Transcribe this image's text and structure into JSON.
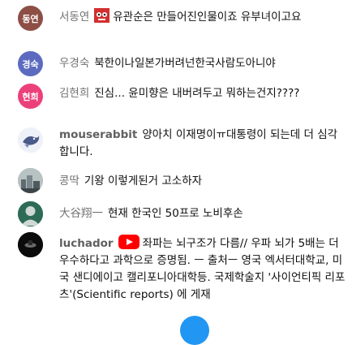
{
  "colors": {
    "avatar_1": "#8d4f45",
    "avatar_2": "#5c6bc0",
    "avatar_3": "#ec407a",
    "avatar_5": "#a9b0ad",
    "avatar_6": "#2e6b57",
    "avatar_7": "#111111",
    "fab": "#2196f3"
  },
  "messages": [
    {
      "avatar_text": "동연",
      "author": "서동연",
      "badge": "mascot-badge-icon",
      "text": "유관순은 만들어진인물이죠 유부녀이고요"
    },
    {
      "avatar_text": "경숙",
      "author": "우경숙",
      "text": "북한이나일본가버려넌한국사람도아니야"
    },
    {
      "avatar_text": "현희",
      "author": "김현희",
      "text": "진심... 윤미향은 내버려두고 뭐하는건지????"
    },
    {
      "avatar_icon": "bird-avatar-icon",
      "author": "mouserabbit",
      "text": "양아치 이재명이ㅠ대통령이 되는데 더 심각합니다."
    },
    {
      "avatar_icon": "city-avatar-icon",
      "author": "콩딱",
      "text": "기왕 이렇게된거 고소하자"
    },
    {
      "avatar_icon": "default-person-avatar-icon",
      "author": "大谷翔一",
      "text": "현재 한국인 50프로 노비후손"
    },
    {
      "avatar_icon": "dark-photo-avatar-icon",
      "author": "luchador",
      "badge": "youtube-icon",
      "text": "좌파는 뇌구조가 다름// 우파 뇌가 5배는 더 우수하다고 과학으로 증명됨. ㅡ 출처ㅡ 영국 엑서터대학교, 미국 샌디에이고 캘리포니아대학등. 국제학술지 '사이언티픽 리포츠'(Scientific reports) 에 게재"
    }
  ]
}
